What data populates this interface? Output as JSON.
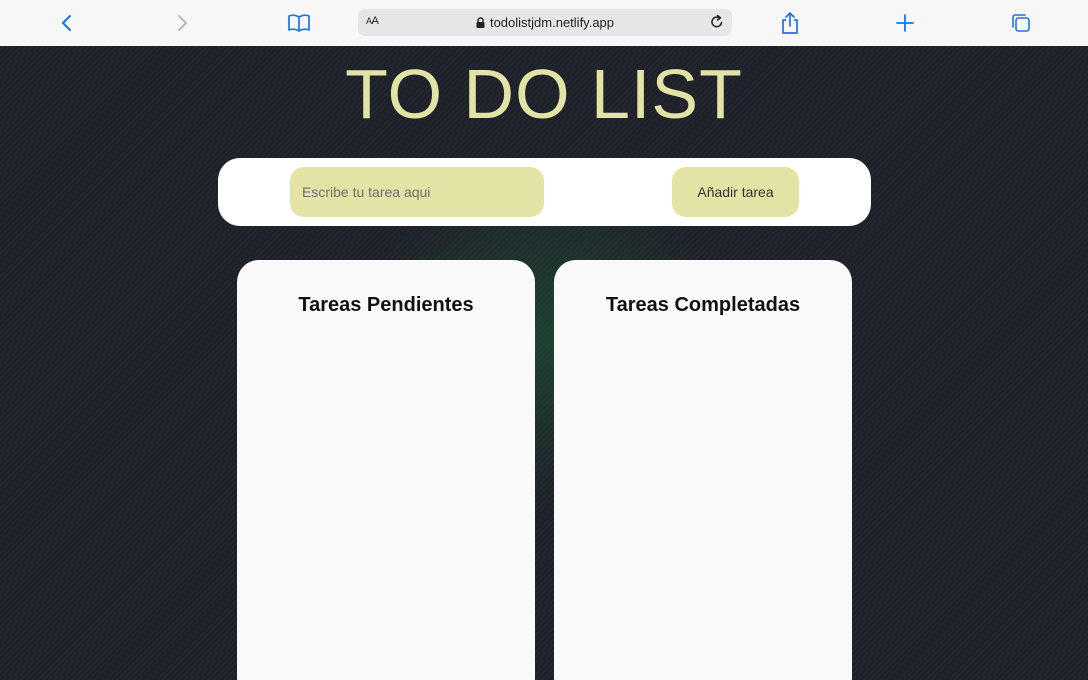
{
  "browser": {
    "reader_label_big": "A",
    "reader_label_small": "A",
    "url": "todolistjdm.netlify.app",
    "icons": [
      "back-icon",
      "forward-icon",
      "bookmarks-icon",
      "lock-icon",
      "reload-icon",
      "share-icon",
      "new-tab-icon",
      "tabs-icon"
    ],
    "accent_color": "#1a73e8"
  },
  "page": {
    "title": "TO DO LIST",
    "input_placeholder": "Escribe tu tarea aqui",
    "input_value": "",
    "add_button_label": "Añadir tarea",
    "columns": {
      "pending_title": "Tareas Pendientes",
      "pending_items": [],
      "completed_title": "Tareas Completadas",
      "completed_items": []
    },
    "colors": {
      "accent": "#e4e3a6",
      "background": "#1c1f26",
      "card": "#f9f9f9"
    }
  }
}
